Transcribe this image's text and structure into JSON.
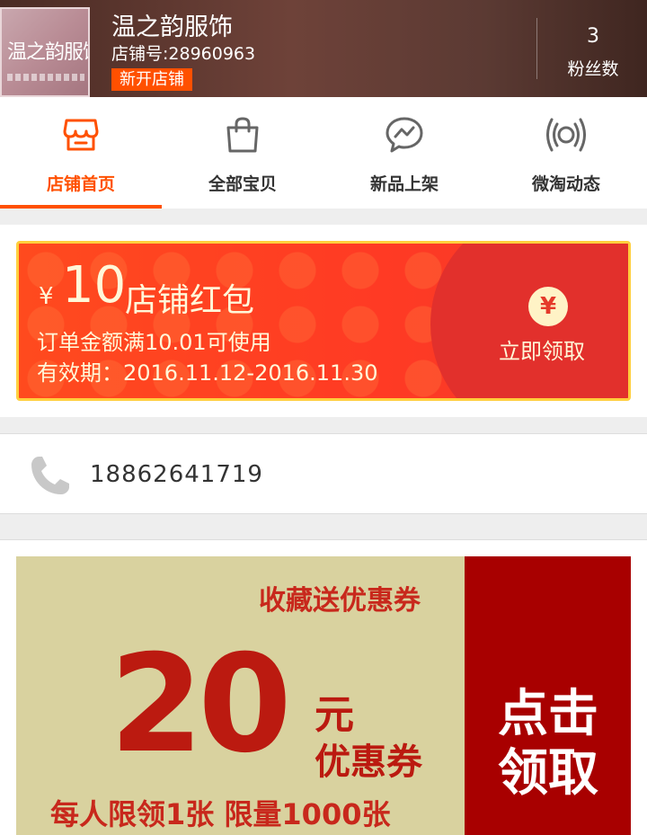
{
  "shop": {
    "logo_text": "温之韵服饰",
    "name": "温之韵服饰",
    "id_text": "店铺号:28960963",
    "badge": "新开店铺",
    "fans_count": "3",
    "fans_label": "粉丝数"
  },
  "nav": {
    "tabs": [
      {
        "label": "店铺首页",
        "icon": "shop-icon",
        "active": true
      },
      {
        "label": "全部宝贝",
        "icon": "bag-icon",
        "active": false
      },
      {
        "label": "新品上架",
        "icon": "chat-bubble-icon",
        "active": false
      },
      {
        "label": "微淘动态",
        "icon": "broadcast-icon",
        "active": false
      }
    ]
  },
  "red_packet": {
    "currency": "¥",
    "amount": "10",
    "title": "店铺红包",
    "condition": "订单金额满10.01可使用",
    "validity": "有效期：2016.11.12-2016.11.30",
    "yen_symbol": "¥",
    "claim_label": "立即领取"
  },
  "phone": {
    "icon": "phone-icon",
    "number": "18862641719"
  },
  "coupon": {
    "header": "收藏送优惠券",
    "amount": "20",
    "unit": "元",
    "type": "优惠券",
    "limit": "每人限领1张  限量1000张",
    "cta_line1": "点击",
    "cta_line2": "领取"
  },
  "colors": {
    "accent": "#ff5000",
    "packet_red": "#ff3a24",
    "coupon_red": "#a80000",
    "coupon_bg": "#d9d29f"
  }
}
